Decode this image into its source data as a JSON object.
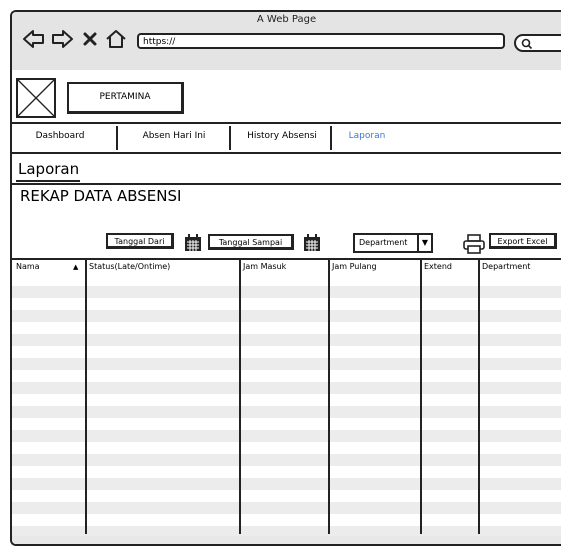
{
  "browser": {
    "title": "A Web Page",
    "url": "https://"
  },
  "brand": {
    "name": "PERTAMINA"
  },
  "tabs": [
    {
      "label": "Dashboard"
    },
    {
      "label": "Absen Hari Ini"
    },
    {
      "label": "History Absensi"
    },
    {
      "label": "Laporan"
    }
  ],
  "page": {
    "section_title": "Laporan",
    "report_title": "REKAP DATA ABSENSI"
  },
  "filters": {
    "date_from_label": "Tanggal Dari",
    "date_to_label": "Tanggal Sampai",
    "department_label": "Department",
    "export_label": "Export Excel"
  },
  "table": {
    "columns": [
      "Nama",
      "Status(Late/Ontime)",
      "Jam Masuk",
      "Jam Pulang",
      "Extend",
      "Department"
    ],
    "sort_indicator": "▲"
  },
  "icons": {
    "back": "arrow-left-icon",
    "forward": "arrow-right-icon",
    "stop": "close-icon",
    "home": "home-icon",
    "search": "search-icon",
    "calendar": "calendar-icon",
    "print": "printer-icon",
    "dropdown": "chevron-down-icon"
  },
  "colors": {
    "accent": "#3a7bd5",
    "row_stripe": "#ececec"
  }
}
